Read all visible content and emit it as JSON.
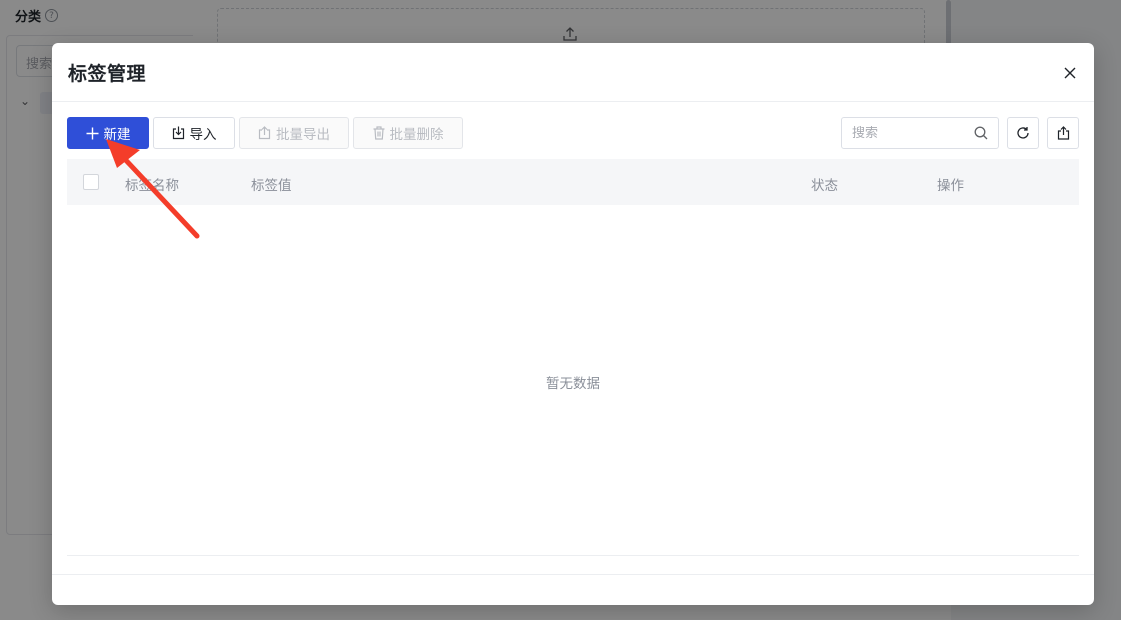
{
  "background": {
    "sidebar": {
      "category_title": "分类",
      "search_placeholder": "搜索"
    }
  },
  "modal": {
    "title": "标签管理",
    "toolbar": {
      "new_label": "新建",
      "import_label": "导入",
      "batch_export_label": "批量导出",
      "batch_delete_label": "批量删除",
      "search_placeholder": "搜索"
    },
    "table": {
      "columns": [
        "标签名称",
        "标签值",
        "状态",
        "操作"
      ],
      "empty_text": "暂无数据"
    }
  },
  "colors": {
    "primary": "#2f4fd8",
    "annotation_arrow": "#f43d2a"
  },
  "icons": [
    "help-icon",
    "chevron-down-icon",
    "folder-icon",
    "upload-icon",
    "close-icon",
    "plus-icon",
    "import-icon",
    "export-icon",
    "trash-icon",
    "search-icon",
    "refresh-icon",
    "share-icon"
  ]
}
